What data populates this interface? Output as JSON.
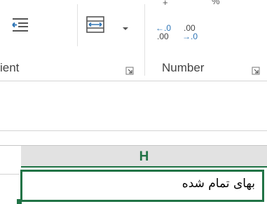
{
  "ribbon": {
    "alignment_label_fragment": "ient",
    "number_label": "Number",
    "top_number_fragment": "%",
    "decimal_increase": {
      "top": "←.0",
      "bottom": ".00"
    },
    "decimal_decrease": {
      "top": ".00",
      "bottom": "→.0"
    },
    "icons": {
      "indent": "decrease-indent-icon",
      "merge": "merge-center-icon",
      "launcher": "dialog-launcher-icon"
    }
  },
  "grid": {
    "column_header": "H",
    "active_cell_value": "بهای تمام شده"
  },
  "colors": {
    "accent": "#217346",
    "header_bg": "#e2e2e2",
    "icon_blue": "#2e75b6"
  }
}
